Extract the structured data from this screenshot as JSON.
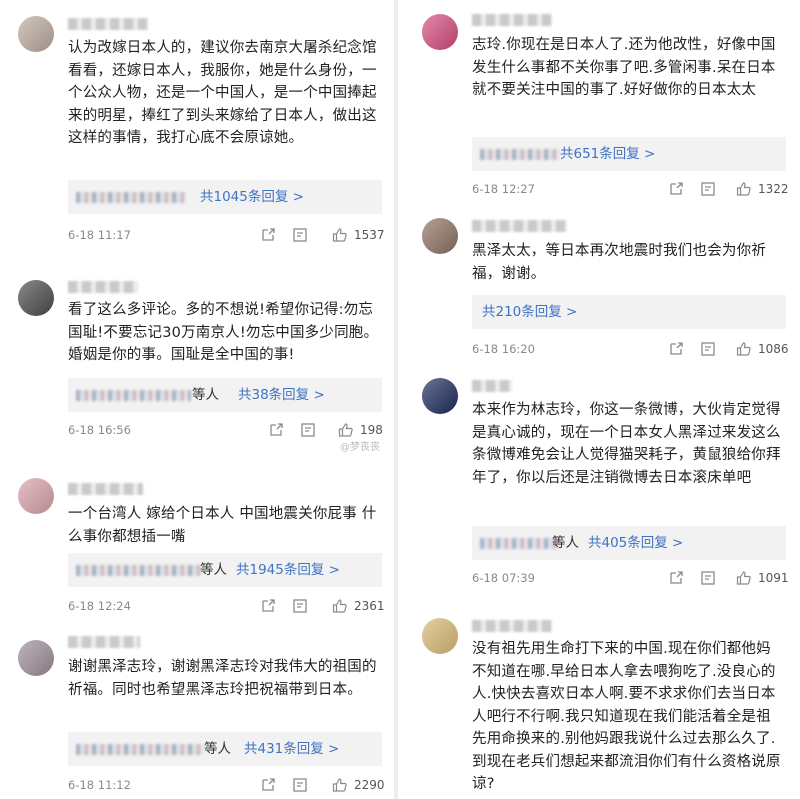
{
  "left": {
    "comments": [
      {
        "avatar_color": "#b9a89c",
        "body": "认为改嫁日本人的，建议你去南京大屠杀纪念馆看看，还嫁日本人，我服你，她是什么身份，一个公众人物，还是一个中国人，是一个中国捧起来的明星，捧红了到头来嫁给了日本人，做出这这样的事情，我打心底不会原谅她。",
        "reply_prefix": "",
        "reply_link": "共1045条回复 >",
        "time": "6-18 11:17",
        "likes": "1537"
      },
      {
        "avatar_color": "#4a4a4a",
        "body": "看了这么多评论。多的不想说!希望你记得:勿忘国耻!不要忘记30万南京人!勿忘中国多少同胞。婚姻是你的事。国耻是全中国的事!",
        "reply_prefix": "等人",
        "reply_link": "共38条回复 >",
        "time": "6-18 16:56",
        "likes": "198",
        "watermark": "@梦丧丧"
      },
      {
        "avatar_color": "#d6a0a8",
        "body": "一个台湾人 嫁给个日本人 中国地震关你屁事 什么事你都想插一嘴",
        "reply_prefix": "等人",
        "reply_link": "共1945条回复 >",
        "time": "6-18 12:24",
        "likes": "2361"
      },
      {
        "avatar_color": "#9c8c98",
        "body": "谢谢黑泽志玲，谢谢黑泽志玲对我伟大的祖国的祈福。同时也希望黑泽志玲把祝福带到日本。",
        "reply_prefix": "等人",
        "reply_link": "共431条回复 >",
        "time": "6-18 11:12",
        "likes": "2290"
      }
    ]
  },
  "right": {
    "comments": [
      {
        "avatar_color": "#d24a7c",
        "body": "志玲.你现在是日本人了.还为他改性，好像中国发生什么事都不关你事了吧.多管闲事.呆在日本就不要关注中国的事了.好好做你的日本太太",
        "reply_prefix": "",
        "reply_link": "共651条回复 >",
        "time": "6-18 12:27",
        "likes": "1322"
      },
      {
        "avatar_color": "#8d6f60",
        "body": "黑泽太太，等日本再次地震时我们也会为你祈福，谢谢。",
        "reply_prefix": "",
        "reply_link": "共210条回复 >",
        "time": "6-18 16:20",
        "likes": "1086"
      },
      {
        "avatar_color": "#1c2a5a",
        "body": "本来作为林志玲，你这一条微博，大伙肯定觉得是真心诚的，现在一个日本女人黑泽过来发这么条微博难免会让人觉得猫哭耗子，黄鼠狼给你拜年了，你以后还是注销微博去日本滚床单吧",
        "reply_prefix": "等人",
        "reply_link": "共405条回复 >",
        "time": "6-18 07:39",
        "likes": "1091"
      },
      {
        "avatar_color": "#d8b873",
        "body": "没有祖先用生命打下来的中国.现在你们都他妈不知道在哪.早给日本人拿去喂狗吃了.没良心的人.快快去喜欢日本人啊.要不求求你们去当日本人吧行不行啊.我只知道现在我们能活着全是祖先用命换来的.别他妈跟我说什么过去那么久了.到现在老兵们想起来都流泪你们有什么资格说原谅?",
        "reply_prefix": "",
        "reply_link": "",
        "time": "",
        "likes": ""
      }
    ]
  }
}
